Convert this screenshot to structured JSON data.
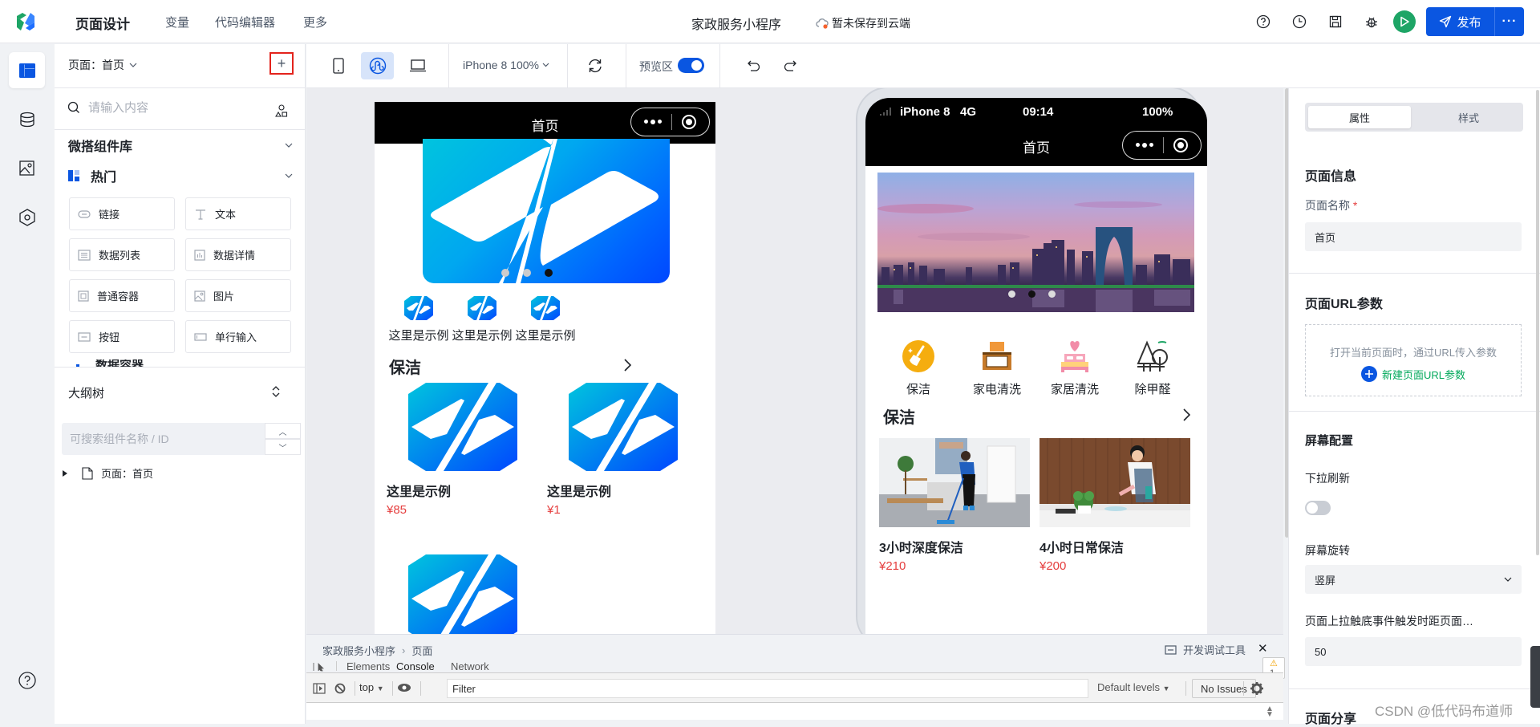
{
  "header": {
    "nav_title": "页面设计",
    "nav_items": [
      "变量",
      "代码编辑器",
      "更多"
    ],
    "app_title": "家政服务小程序",
    "save_status": "暂未保存到云端",
    "icons": [
      "help-icon",
      "history-icon",
      "save-icon",
      "debug-icon"
    ],
    "publish_label": "发布",
    "publish_more": "···",
    "colors": {
      "primary": "#0a56e1",
      "run": "#1ea566"
    }
  },
  "left_rail": {
    "items": [
      "page-design",
      "database",
      "media",
      "settings"
    ],
    "help": "help-icon"
  },
  "left_panel": {
    "page_selector": "页面：首页",
    "add_page": "+",
    "search_placeholder": "请输入内容",
    "library_title": "微搭组件库",
    "hot_title": "热门",
    "components": [
      {
        "label": "链接",
        "icon": "link-icon"
      },
      {
        "label": "文本",
        "icon": "text-icon"
      },
      {
        "label": "数据列表",
        "icon": "list-icon"
      },
      {
        "label": "数据详情",
        "icon": "chart-icon"
      },
      {
        "label": "普通容器",
        "icon": "container-icon"
      },
      {
        "label": "图片",
        "icon": "image-icon"
      },
      {
        "label": "按钮",
        "icon": "button-icon"
      },
      {
        "label": "单行输入",
        "icon": "input-icon"
      }
    ],
    "next_section_partial": "数据容器",
    "outline": {
      "title": "大纲树",
      "search_placeholder": "可搜索组件名称 / ID",
      "node": "页面：首页"
    }
  },
  "toolbar": {
    "device": "iPhone 8 100%",
    "preview_label": "预览区",
    "preview_on": true
  },
  "simulator_left": {
    "nav_title": "首页",
    "swiper_active_index": 2,
    "swiper_count": 3,
    "grid_items": [
      "这里是示例",
      "这里是示例",
      "这里是示例"
    ],
    "section_title": "保洁",
    "products": [
      {
        "name": "这里是示例",
        "price": "¥85"
      },
      {
        "name": "这里是示例",
        "price": "¥1"
      }
    ]
  },
  "simulator_right": {
    "status": {
      "carrier": "iPhone 8",
      "network": "4G",
      "time": "09:14",
      "battery": "100%"
    },
    "nav_title": "首页",
    "swiper_active_index": 1,
    "swiper_count": 3,
    "categories": [
      {
        "label": "保洁",
        "icon": "broom-icon"
      },
      {
        "label": "家电清洗",
        "icon": "range-hood-icon"
      },
      {
        "label": "家居清洗",
        "icon": "bed-icon"
      },
      {
        "label": "除甲醛",
        "icon": "tree-icon"
      }
    ],
    "section_title": "保洁",
    "products": [
      {
        "name": "3小时深度保洁",
        "price": "¥210"
      },
      {
        "name": "4小时日常保洁",
        "price": "¥200"
      }
    ]
  },
  "devtools": {
    "breadcrumb": [
      "家政服务小程序",
      "页面"
    ],
    "title": "开发调试工具",
    "tabs": [
      "Elements",
      "Console",
      "Network"
    ],
    "active_tab": "Console",
    "warnings": "1",
    "context": "top",
    "filter_placeholder": "Filter",
    "levels": "Default levels",
    "issues": "No Issues"
  },
  "right_panel": {
    "tabs": [
      "属性",
      "样式"
    ],
    "active_tab": "属性",
    "page_info_title": "页面信息",
    "page_name_label": "页面名称",
    "required_mark": "*",
    "page_name_value": "首页",
    "url_params_title": "页面URL参数",
    "url_params_hint": "打开当前页面时，通过URL传入参数",
    "url_params_add": "新建页面URL参数",
    "screen_config_title": "屏幕配置",
    "pull_refresh_label": "下拉刷新",
    "pull_refresh_on": false,
    "rotation_label": "屏幕旋转",
    "rotation_value": "竖屏",
    "reach_bottom_label": "页面上拉触底事件触发时距页面…",
    "reach_bottom_value": "50",
    "share_title": "页面分享"
  },
  "watermark": "CSDN @低代码布道师"
}
